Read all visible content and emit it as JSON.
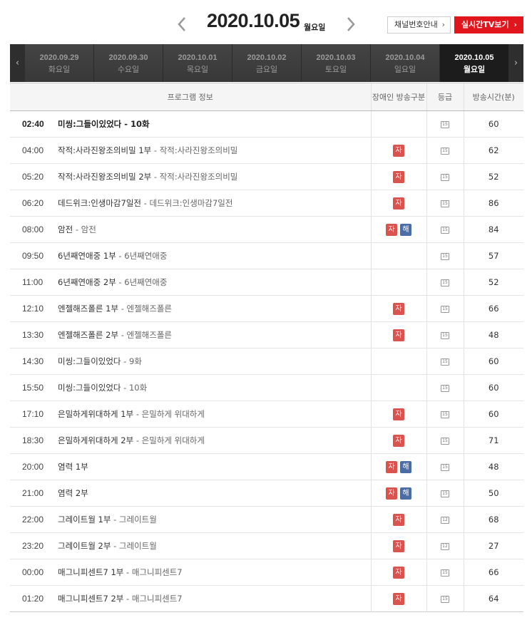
{
  "header": {
    "current_date": "2020.10.05",
    "current_day": "월요일",
    "channel_button": "채널번호안내",
    "live_button": "실시간TV보기"
  },
  "date_tabs": [
    {
      "date": "2020.09.29",
      "day": "화요일",
      "active": false
    },
    {
      "date": "2020.09.30",
      "day": "수요일",
      "active": false
    },
    {
      "date": "2020.10.01",
      "day": "목요일",
      "active": false
    },
    {
      "date": "2020.10.02",
      "day": "금요일",
      "active": false
    },
    {
      "date": "2020.10.03",
      "day": "토요일",
      "active": false
    },
    {
      "date": "2020.10.04",
      "day": "일요일",
      "active": false
    },
    {
      "date": "2020.10.05",
      "day": "월요일",
      "active": true
    }
  ],
  "table": {
    "headers": [
      "프로그램 정보",
      "장애인 방송구분",
      "등급",
      "방송시간(분)"
    ],
    "rows": [
      {
        "time": "02:40",
        "title": "미씽:그들이있었다",
        "sub": "10화",
        "ja": false,
        "hae": false,
        "rating": "15",
        "duration": "60",
        "live": true
      },
      {
        "time": "04:00",
        "title": "작적:사라진왕조의비밀 1부",
        "sub": "작적:사라진왕조의비밀",
        "ja": true,
        "hae": false,
        "rating": "15",
        "duration": "62",
        "live": false
      },
      {
        "time": "05:20",
        "title": "작적:사라진왕조의비밀 2부",
        "sub": "작적:사라진왕조의비밀",
        "ja": true,
        "hae": false,
        "rating": "15",
        "duration": "52",
        "live": false
      },
      {
        "time": "06:20",
        "title": "데드위크:인생마감7일전",
        "sub": "데드위크:인생마감7일전",
        "ja": true,
        "hae": false,
        "rating": "15",
        "duration": "86",
        "live": false
      },
      {
        "time": "08:00",
        "title": "암전",
        "sub": "암전",
        "ja": true,
        "hae": true,
        "rating": "15",
        "duration": "84",
        "live": false
      },
      {
        "time": "09:50",
        "title": "6년째연애중 1부",
        "sub": "6년째연애중",
        "ja": false,
        "hae": false,
        "rating": "15",
        "duration": "57",
        "live": false
      },
      {
        "time": "11:00",
        "title": "6년째연애중 2부",
        "sub": "6년째연애중",
        "ja": false,
        "hae": false,
        "rating": "15",
        "duration": "52",
        "live": false
      },
      {
        "time": "12:10",
        "title": "엔젤해즈폴른 1부",
        "sub": "엔젤해즈폴른",
        "ja": true,
        "hae": false,
        "rating": "15",
        "duration": "66",
        "live": false
      },
      {
        "time": "13:30",
        "title": "엔젤해즈폴른 2부",
        "sub": "엔젤해즈폴른",
        "ja": true,
        "hae": false,
        "rating": "15",
        "duration": "48",
        "live": false
      },
      {
        "time": "14:30",
        "title": "미씽:그들이있었다",
        "sub": "9화",
        "ja": false,
        "hae": false,
        "rating": "15",
        "duration": "60",
        "live": false
      },
      {
        "time": "15:50",
        "title": "미씽:그들이있었다",
        "sub": "10화",
        "ja": false,
        "hae": false,
        "rating": "15",
        "duration": "60",
        "live": false
      },
      {
        "time": "17:10",
        "title": "은밀하게위대하게 1부",
        "sub": "은밀하게 위대하게",
        "ja": true,
        "hae": false,
        "rating": "15",
        "duration": "60",
        "live": false
      },
      {
        "time": "18:30",
        "title": "은밀하게위대하게 2부",
        "sub": "은밀하게 위대하게",
        "ja": true,
        "hae": false,
        "rating": "15",
        "duration": "71",
        "live": false
      },
      {
        "time": "20:00",
        "title": "염력 1부",
        "sub": "",
        "ja": true,
        "hae": true,
        "rating": "15",
        "duration": "48",
        "live": false
      },
      {
        "time": "21:00",
        "title": "염력 2부",
        "sub": "",
        "ja": true,
        "hae": true,
        "rating": "15",
        "duration": "50",
        "live": false
      },
      {
        "time": "22:00",
        "title": "그레이트월 1부",
        "sub": "그레이트월",
        "ja": true,
        "hae": false,
        "rating": "12",
        "duration": "68",
        "live": false
      },
      {
        "time": "23:20",
        "title": "그레이트월 2부",
        "sub": "그레이트월",
        "ja": true,
        "hae": false,
        "rating": "12",
        "duration": "27",
        "live": false
      },
      {
        "time": "00:00",
        "title": "매그니피센트7 1부",
        "sub": "매그니피센트7",
        "ja": true,
        "hae": false,
        "rating": "15",
        "duration": "66",
        "live": false
      },
      {
        "time": "01:20",
        "title": "매그니피센트7 2부",
        "sub": "매그니피센트7",
        "ja": true,
        "hae": false,
        "rating": "15",
        "duration": "64",
        "live": false
      }
    ]
  },
  "badges": {
    "ja_label": "자",
    "hae_label": "해",
    "separator": " - "
  },
  "colors": {
    "accent": "#e1161d",
    "ja_badge": "#d9534f",
    "hae_badge": "#4a6da6",
    "strip_bg": "#3a3a3a",
    "strip_active": "#1c1c1c"
  }
}
